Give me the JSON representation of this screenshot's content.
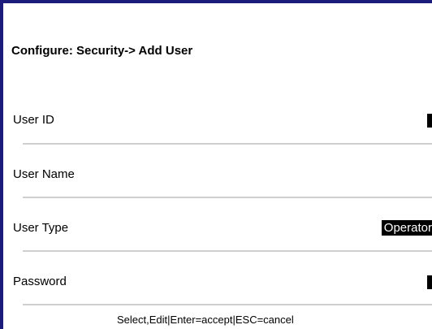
{
  "screen": {
    "title": "Configure: Security-> Add User"
  },
  "form": {
    "fields": [
      {
        "label": "User ID",
        "value": ""
      },
      {
        "label": "User Name",
        "value": ""
      },
      {
        "label": "User Type",
        "value": "Operator"
      },
      {
        "label": "Password",
        "value": ""
      }
    ]
  },
  "footer": {
    "hint": "Select,Edit|Enter=accept|ESC=cancel"
  },
  "colors": {
    "frame": "#1c1c7c",
    "divider": "#cfcfcf",
    "selected_bg": "#000000",
    "selected_text": "#ffffff"
  }
}
